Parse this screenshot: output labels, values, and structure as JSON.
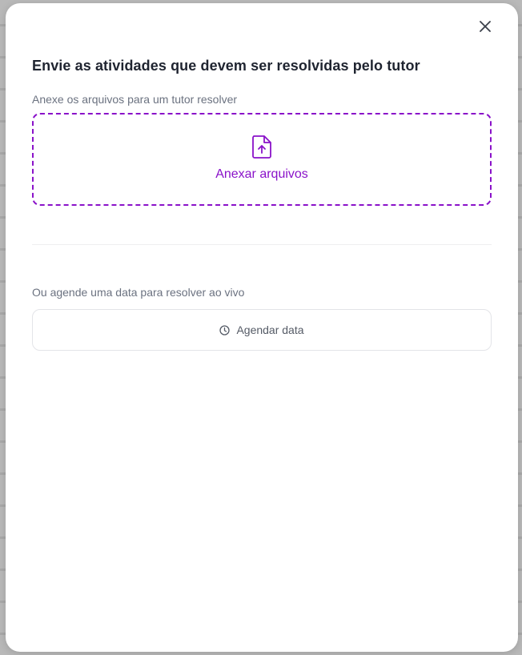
{
  "modal": {
    "title": "Envie as atividades que devem ser resolvidas pelo tutor",
    "close_icon": "close-icon"
  },
  "attach": {
    "label": "Anexe os arquivos para um tutor resolver",
    "button_label": "Anexar arquivos",
    "icon": "file-upload-icon",
    "accent_color": "#8a12c9"
  },
  "schedule": {
    "label": "Ou agende uma data para resolver ao vivo",
    "button_label": "Agendar data",
    "icon": "clock-icon"
  }
}
